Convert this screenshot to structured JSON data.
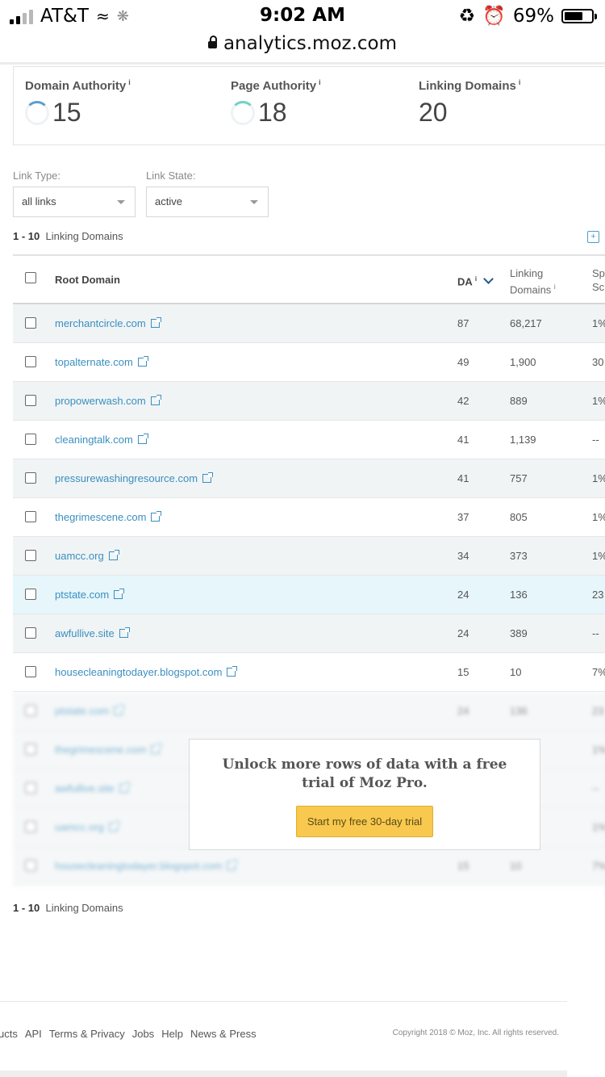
{
  "status_bar": {
    "carrier": "AT&T",
    "time": "9:02 AM",
    "battery": "69%",
    "battery_level": 0.69
  },
  "url_bar": {
    "url": "analytics.moz.com"
  },
  "metrics": [
    {
      "label": "Domain Authority",
      "info": "i",
      "value": "15",
      "ring_color": "#5b9fd0"
    },
    {
      "label": "Page Authority",
      "info": "i",
      "value": "18",
      "ring_color": "#6fd3c4"
    },
    {
      "label": "Linking Domains",
      "info": "i",
      "value": "20"
    }
  ],
  "filters": {
    "link_type": {
      "label": "Link Type:",
      "value": "all links"
    },
    "link_state": {
      "label": "Link State:",
      "value": "active"
    }
  },
  "range": {
    "bold": "1 - 10",
    "text": "Linking Domains"
  },
  "table": {
    "headers": {
      "root_domain": "Root Domain",
      "da": "DA",
      "da_info": "i",
      "linking_1": "Linking",
      "linking_2": "Domains",
      "linking_info": "i",
      "spam_1": "Sp",
      "spam_2": "Sc"
    },
    "rows": [
      {
        "domain": "merchantcircle.com",
        "da": "87",
        "ld": "68,217",
        "ss": "1%"
      },
      {
        "domain": "topalternate.com",
        "da": "49",
        "ld": "1,900",
        "ss": "30"
      },
      {
        "domain": "propowerwash.com",
        "da": "42",
        "ld": "889",
        "ss": "1%"
      },
      {
        "domain": "cleaningtalk.com",
        "da": "41",
        "ld": "1,139",
        "ss": "--"
      },
      {
        "domain": "pressurewashingresource.com",
        "da": "41",
        "ld": "757",
        "ss": "1%"
      },
      {
        "domain": "thegrimescene.com",
        "da": "37",
        "ld": "805",
        "ss": "1%"
      },
      {
        "domain": "uamcc.org",
        "da": "34",
        "ld": "373",
        "ss": "1%"
      },
      {
        "domain": "ptstate.com",
        "da": "24",
        "ld": "136",
        "ss": "23"
      },
      {
        "domain": "awfullive.site",
        "da": "24",
        "ld": "389",
        "ss": "--"
      },
      {
        "domain": "housecleaningtodayer.blogspot.com",
        "da": "15",
        "ld": "10",
        "ss": "7%"
      }
    ],
    "blurred_rows": [
      {
        "domain": "ptstate.com",
        "da": "24",
        "ld": "136",
        "ss": "23"
      },
      {
        "domain": "thegrimescene.com",
        "da": "",
        "ld": "",
        "ss": "1%"
      },
      {
        "domain": "awfullive.site",
        "da": "",
        "ld": "",
        "ss": "--"
      },
      {
        "domain": "uamcc.org",
        "da": "",
        "ld": "",
        "ss": "1%"
      },
      {
        "domain": "housecleaningtodayer.blogspot.com",
        "da": "15",
        "ld": "10",
        "ss": "7%"
      }
    ]
  },
  "upsell": {
    "message": "Unlock more rows of data with a free trial of Moz Pro.",
    "cta": "Start my free 30-day trial"
  },
  "footer": {
    "links": [
      "ucts",
      "API",
      "Terms & Privacy",
      "Jobs",
      "Help",
      "News & Press"
    ],
    "copyright": "Copyright 2018 © Moz, Inc. All rights reserved."
  }
}
